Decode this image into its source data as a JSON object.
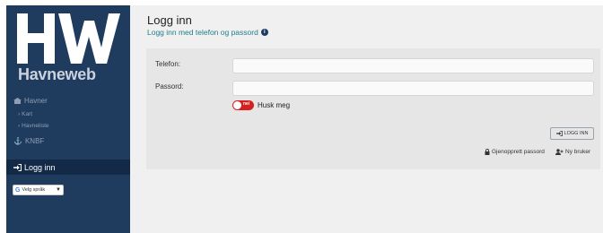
{
  "sidebar": {
    "logo": {
      "mark": "HW",
      "name": "Havneweb"
    },
    "items": [
      {
        "label": "Havner",
        "icon": "harbor-icon"
      },
      {
        "label": "Kart",
        "icon": "chevron-right-icon"
      },
      {
        "label": "Havneliste",
        "icon": "chevron-right-icon"
      },
      {
        "label": "KNBF",
        "icon": "anchor-icon"
      }
    ],
    "active": {
      "label": "Logg inn",
      "icon": "sign-in-icon"
    },
    "language": {
      "label": "Velg språk",
      "caret": "▼"
    }
  },
  "main": {
    "title": "Logg inn",
    "subtitle": "Logg inn med telefon og passord",
    "form": {
      "phone_label": "Telefon:",
      "phone_value": "",
      "password_label": "Passord:",
      "password_value": "",
      "toggle_text": "nei",
      "remember_label": "Husk meg",
      "login_button": "LOGG INN",
      "forgot_link": "Gjenopprett passord",
      "new_user_link": "Ny bruker"
    }
  },
  "colors": {
    "sidebar_bg": "#1f3b5e",
    "active_bg": "#122a47",
    "accent_teal": "#1d7f8a",
    "toggle_red": "#d62020"
  }
}
